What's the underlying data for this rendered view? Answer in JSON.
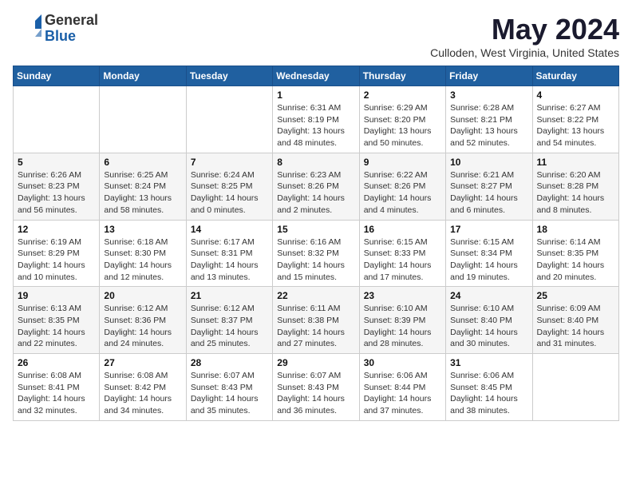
{
  "logo": {
    "general": "General",
    "blue": "Blue"
  },
  "header": {
    "month": "May 2024",
    "location": "Culloden, West Virginia, United States"
  },
  "weekdays": [
    "Sunday",
    "Monday",
    "Tuesday",
    "Wednesday",
    "Thursday",
    "Friday",
    "Saturday"
  ],
  "weeks": [
    [
      {
        "day": "",
        "info": ""
      },
      {
        "day": "",
        "info": ""
      },
      {
        "day": "",
        "info": ""
      },
      {
        "day": "1",
        "info": "Sunrise: 6:31 AM\nSunset: 8:19 PM\nDaylight: 13 hours\nand 48 minutes."
      },
      {
        "day": "2",
        "info": "Sunrise: 6:29 AM\nSunset: 8:20 PM\nDaylight: 13 hours\nand 50 minutes."
      },
      {
        "day": "3",
        "info": "Sunrise: 6:28 AM\nSunset: 8:21 PM\nDaylight: 13 hours\nand 52 minutes."
      },
      {
        "day": "4",
        "info": "Sunrise: 6:27 AM\nSunset: 8:22 PM\nDaylight: 13 hours\nand 54 minutes."
      }
    ],
    [
      {
        "day": "5",
        "info": "Sunrise: 6:26 AM\nSunset: 8:23 PM\nDaylight: 13 hours\nand 56 minutes."
      },
      {
        "day": "6",
        "info": "Sunrise: 6:25 AM\nSunset: 8:24 PM\nDaylight: 13 hours\nand 58 minutes."
      },
      {
        "day": "7",
        "info": "Sunrise: 6:24 AM\nSunset: 8:25 PM\nDaylight: 14 hours\nand 0 minutes."
      },
      {
        "day": "8",
        "info": "Sunrise: 6:23 AM\nSunset: 8:26 PM\nDaylight: 14 hours\nand 2 minutes."
      },
      {
        "day": "9",
        "info": "Sunrise: 6:22 AM\nSunset: 8:26 PM\nDaylight: 14 hours\nand 4 minutes."
      },
      {
        "day": "10",
        "info": "Sunrise: 6:21 AM\nSunset: 8:27 PM\nDaylight: 14 hours\nand 6 minutes."
      },
      {
        "day": "11",
        "info": "Sunrise: 6:20 AM\nSunset: 8:28 PM\nDaylight: 14 hours\nand 8 minutes."
      }
    ],
    [
      {
        "day": "12",
        "info": "Sunrise: 6:19 AM\nSunset: 8:29 PM\nDaylight: 14 hours\nand 10 minutes."
      },
      {
        "day": "13",
        "info": "Sunrise: 6:18 AM\nSunset: 8:30 PM\nDaylight: 14 hours\nand 12 minutes."
      },
      {
        "day": "14",
        "info": "Sunrise: 6:17 AM\nSunset: 8:31 PM\nDaylight: 14 hours\nand 13 minutes."
      },
      {
        "day": "15",
        "info": "Sunrise: 6:16 AM\nSunset: 8:32 PM\nDaylight: 14 hours\nand 15 minutes."
      },
      {
        "day": "16",
        "info": "Sunrise: 6:15 AM\nSunset: 8:33 PM\nDaylight: 14 hours\nand 17 minutes."
      },
      {
        "day": "17",
        "info": "Sunrise: 6:15 AM\nSunset: 8:34 PM\nDaylight: 14 hours\nand 19 minutes."
      },
      {
        "day": "18",
        "info": "Sunrise: 6:14 AM\nSunset: 8:35 PM\nDaylight: 14 hours\nand 20 minutes."
      }
    ],
    [
      {
        "day": "19",
        "info": "Sunrise: 6:13 AM\nSunset: 8:35 PM\nDaylight: 14 hours\nand 22 minutes."
      },
      {
        "day": "20",
        "info": "Sunrise: 6:12 AM\nSunset: 8:36 PM\nDaylight: 14 hours\nand 24 minutes."
      },
      {
        "day": "21",
        "info": "Sunrise: 6:12 AM\nSunset: 8:37 PM\nDaylight: 14 hours\nand 25 minutes."
      },
      {
        "day": "22",
        "info": "Sunrise: 6:11 AM\nSunset: 8:38 PM\nDaylight: 14 hours\nand 27 minutes."
      },
      {
        "day": "23",
        "info": "Sunrise: 6:10 AM\nSunset: 8:39 PM\nDaylight: 14 hours\nand 28 minutes."
      },
      {
        "day": "24",
        "info": "Sunrise: 6:10 AM\nSunset: 8:40 PM\nDaylight: 14 hours\nand 30 minutes."
      },
      {
        "day": "25",
        "info": "Sunrise: 6:09 AM\nSunset: 8:40 PM\nDaylight: 14 hours\nand 31 minutes."
      }
    ],
    [
      {
        "day": "26",
        "info": "Sunrise: 6:08 AM\nSunset: 8:41 PM\nDaylight: 14 hours\nand 32 minutes."
      },
      {
        "day": "27",
        "info": "Sunrise: 6:08 AM\nSunset: 8:42 PM\nDaylight: 14 hours\nand 34 minutes."
      },
      {
        "day": "28",
        "info": "Sunrise: 6:07 AM\nSunset: 8:43 PM\nDaylight: 14 hours\nand 35 minutes."
      },
      {
        "day": "29",
        "info": "Sunrise: 6:07 AM\nSunset: 8:43 PM\nDaylight: 14 hours\nand 36 minutes."
      },
      {
        "day": "30",
        "info": "Sunrise: 6:06 AM\nSunset: 8:44 PM\nDaylight: 14 hours\nand 37 minutes."
      },
      {
        "day": "31",
        "info": "Sunrise: 6:06 AM\nSunset: 8:45 PM\nDaylight: 14 hours\nand 38 minutes."
      },
      {
        "day": "",
        "info": ""
      }
    ]
  ]
}
